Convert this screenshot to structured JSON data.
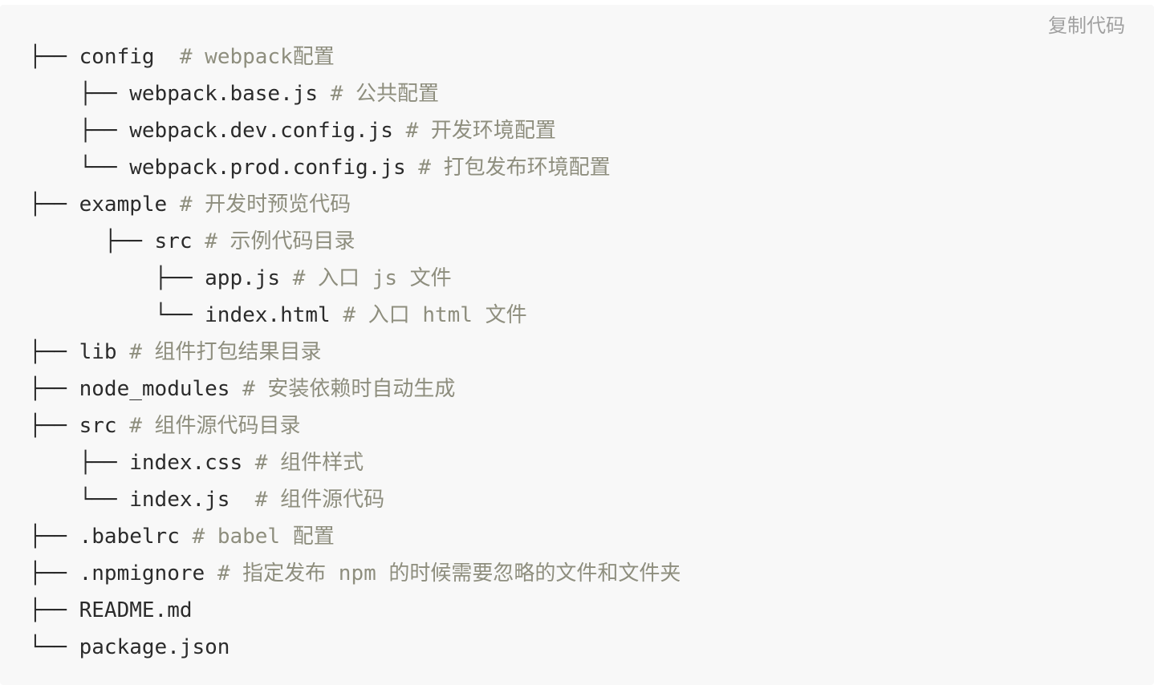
{
  "toolbar": {
    "copy_label": "复制代码"
  },
  "tree": [
    {
      "prefix": "├── ",
      "name": "config",
      "comment": "  # webpack配置"
    },
    {
      "prefix": "    ├── ",
      "name": "webpack.base.js",
      "comment": " # 公共配置"
    },
    {
      "prefix": "    ├── ",
      "name": "webpack.dev.config.js",
      "comment": " # 开发环境配置"
    },
    {
      "prefix": "    └── ",
      "name": "webpack.prod.config.js",
      "comment": " # 打包发布环境配置"
    },
    {
      "prefix": "├── ",
      "name": "example",
      "comment": " # 开发时预览代码"
    },
    {
      "prefix": "      ├── ",
      "name": "src",
      "comment": " # 示例代码目录"
    },
    {
      "prefix": "          ├── ",
      "name": "app.js",
      "comment": " # 入口 js 文件"
    },
    {
      "prefix": "          └── ",
      "name": "index.html",
      "comment": " # 入口 html 文件"
    },
    {
      "prefix": "├── ",
      "name": "lib",
      "comment": " # 组件打包结果目录"
    },
    {
      "prefix": "├── ",
      "name": "node_modules",
      "comment": " # 安装依赖时自动生成"
    },
    {
      "prefix": "├── ",
      "name": "src",
      "comment": " # 组件源代码目录"
    },
    {
      "prefix": "    ├── ",
      "name": "index.css",
      "comment": " # 组件样式"
    },
    {
      "prefix": "    └── ",
      "name": "index.js",
      "comment": "  # 组件源代码"
    },
    {
      "prefix": "├── ",
      "name": ".babelrc",
      "comment": " # babel 配置"
    },
    {
      "prefix": "├── ",
      "name": ".npmignore",
      "comment": " # 指定发布 npm 的时候需要忽略的文件和文件夹"
    },
    {
      "prefix": "├── ",
      "name": "README.md",
      "comment": ""
    },
    {
      "prefix": "└── ",
      "name": "package.json",
      "comment": ""
    }
  ]
}
